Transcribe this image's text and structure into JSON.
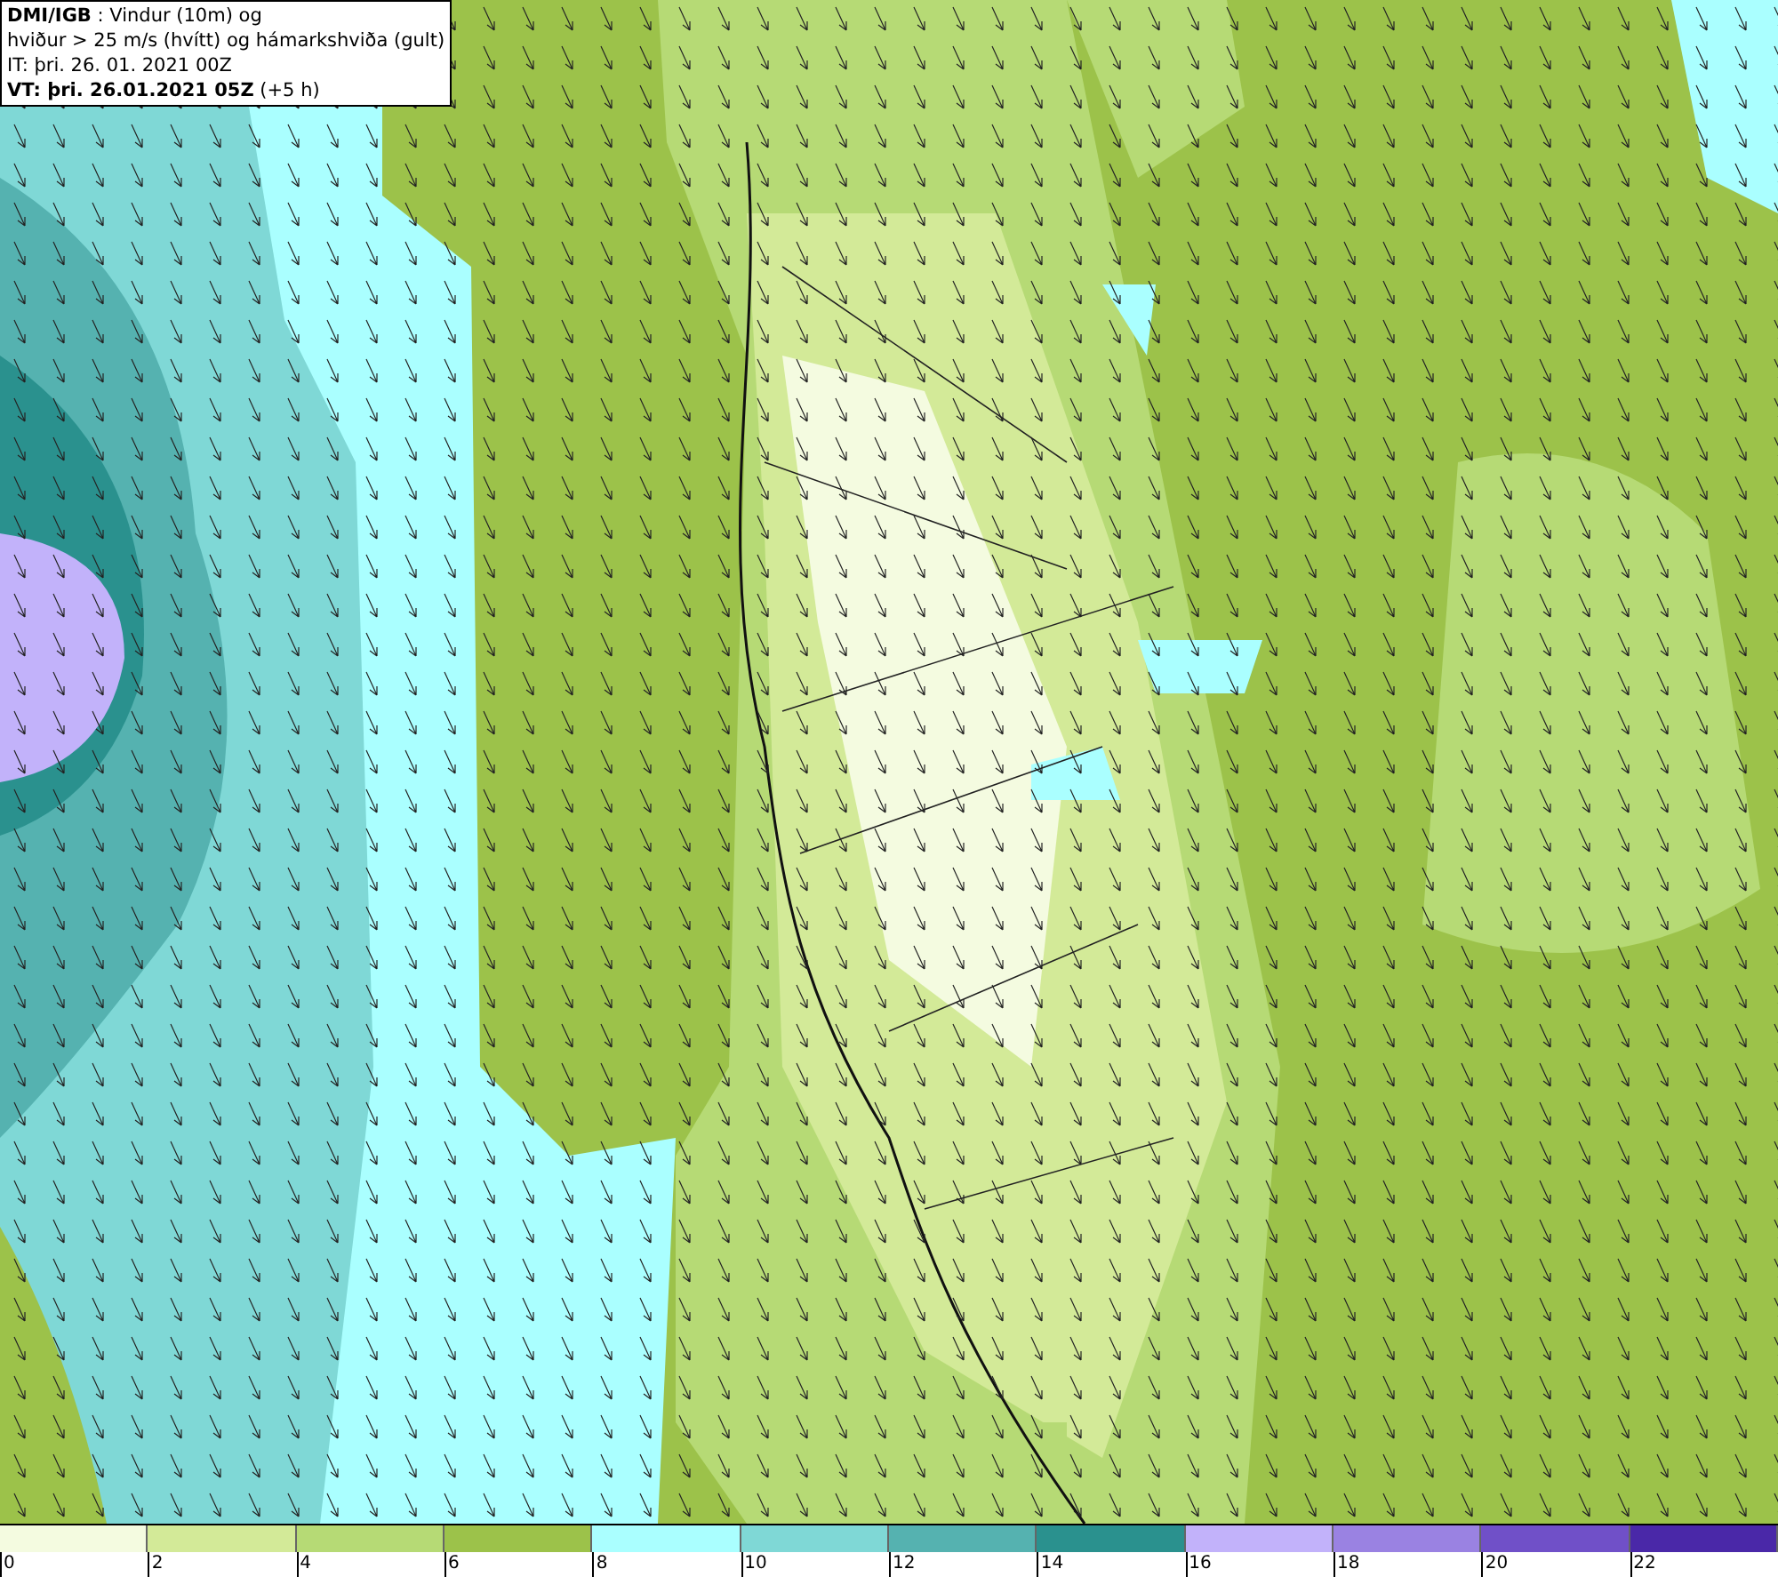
{
  "title_box": {
    "lines": [
      "**DMI/IGB** : Vindur (10m) og",
      "hviður > 25 m/s (hvítt) og hámarkshviða (gult)",
      "IT: þri. 26. 01. 2021 00Z",
      "**VT: þri. 26.01.2021 05Z** (+5 h)"
    ]
  },
  "legend": {
    "swatches": [
      {
        "color": "#f4fbe0"
      },
      {
        "color": "#d3ea98"
      },
      {
        "color": "#b6da75"
      },
      {
        "color": "#9cc24a"
      },
      {
        "color": "#aaffff"
      },
      {
        "color": "#7fd8d6"
      },
      {
        "color": "#55b2b0"
      },
      {
        "color": "#2a918e"
      },
      {
        "color": "#c2b2fa"
      },
      {
        "color": "#9a82e2"
      },
      {
        "color": "#7050c8"
      },
      {
        "color": "#4a28a8"
      }
    ],
    "ticks": [
      "0",
      "2",
      "4",
      "6",
      "8",
      "10",
      "12",
      "14",
      "16",
      "18",
      "20",
      "22"
    ]
  }
}
